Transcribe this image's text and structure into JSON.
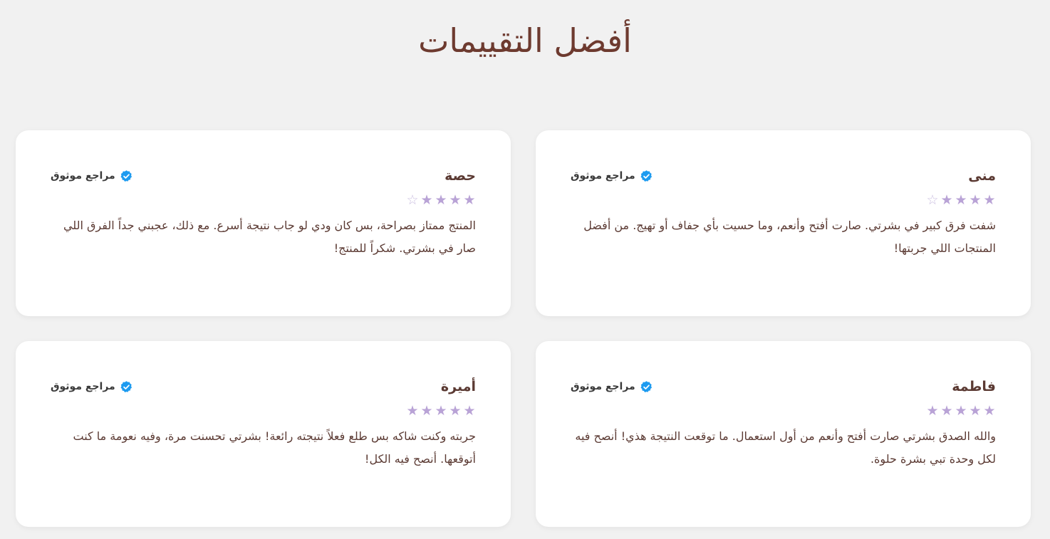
{
  "page": {
    "title": "أفضل التقييمات"
  },
  "colors": {
    "background": "#f1f1f1",
    "card": "#ffffff",
    "title": "#6d3a2f",
    "text": "#5b3a33",
    "star": "#b9a3d6",
    "verified_badge": "#1d9bf0"
  },
  "reviews": [
    {
      "name": "منى",
      "badge": "مراجع موثوق",
      "rating": 4,
      "max_rating": 5,
      "text": "شفت فرق كبير في بشرتي. صارت أفتح وأنعم، وما حسيت بأي جفاف أو تهيج. من أفضل المنتجات اللي جربتها!"
    },
    {
      "name": "حصة",
      "badge": "مراجع موثوق",
      "rating": 4,
      "max_rating": 5,
      "text": "المنتج ممتاز بصراحة، بس كان ودي لو جاب نتيجة أسرع. مع ذلك، عجبني جداً الفرق اللي صار في بشرتي. شكراً للمنتج!"
    },
    {
      "name": "فاطمة",
      "badge": "مراجع موثوق",
      "rating": 5,
      "max_rating": 5,
      "text": "والله الصدق بشرتي صارت أفتح وأنعم من أول استعمال. ما توقعت النتيجة هذي! أنصح فيه لكل وحدة تبي بشرة حلوة."
    },
    {
      "name": "أميرة",
      "badge": "مراجع موثوق",
      "rating": 5,
      "max_rating": 5,
      "text": "جربته وكنت شاكه بس طلع فعلاً نتيجته رائعة! بشرتي تحسنت مرة، وفيه نعومة ما كنت أتوقعها. أنصح فيه الكل!"
    }
  ],
  "icons": {
    "verified": "verified-badge-icon",
    "star_filled": "star-filled-icon",
    "star_empty": "star-outline-icon"
  }
}
